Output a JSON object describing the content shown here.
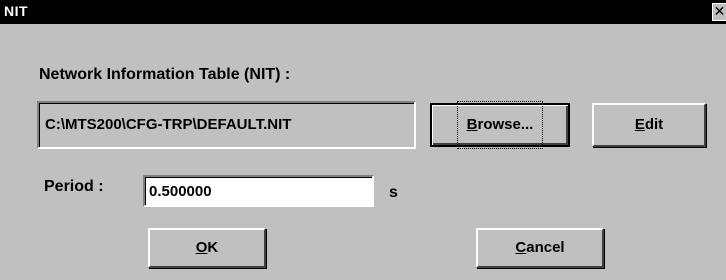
{
  "window": {
    "title": "NIT",
    "close_glyph": "✕"
  },
  "nit": {
    "label": "Network Information Table (NIT) :",
    "path": "C:\\MTS200\\CFG-TRP\\DEFAULT.NIT"
  },
  "buttons": {
    "browse": "Browse...",
    "edit": "Edit",
    "ok": "OK",
    "cancel": "Cancel"
  },
  "period": {
    "label": "Period :",
    "value": "0.500000",
    "unit": "s"
  }
}
